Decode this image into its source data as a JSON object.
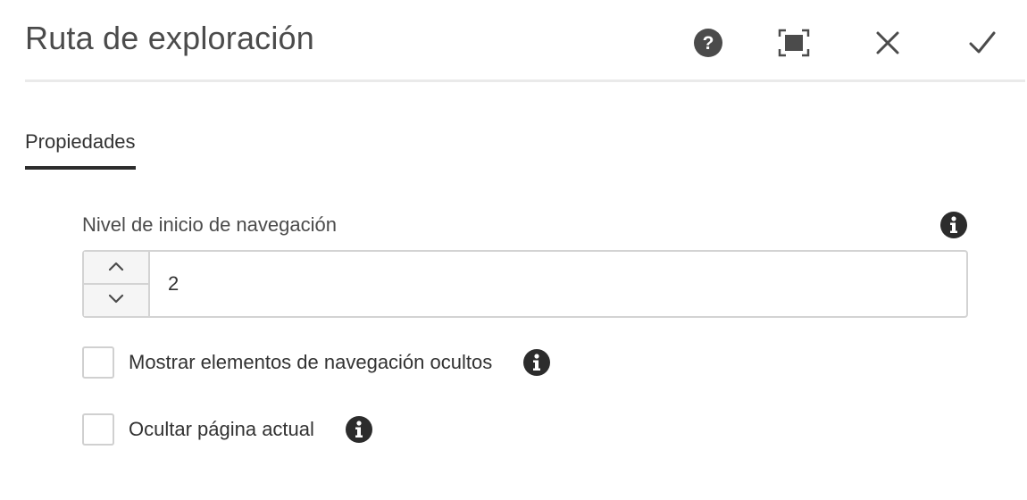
{
  "dialog": {
    "title": "Ruta de exploración",
    "actions": {
      "help_icon": "help-icon",
      "fullscreen_icon": "fullscreen-icon",
      "cancel_icon": "close-icon",
      "done_icon": "checkmark-icon"
    }
  },
  "tabs": [
    {
      "label": "Propiedades",
      "active": true
    }
  ],
  "fields": {
    "start_level": {
      "label": "Nivel de inicio de navegación",
      "value": "2",
      "info_icon": "info-icon",
      "increment_icon": "chevron-up-icon",
      "decrement_icon": "chevron-down-icon"
    },
    "show_hidden": {
      "label": "Mostrar elementos de navegación ocultos",
      "checked": false,
      "info_icon": "info-icon"
    },
    "hide_current": {
      "label": "Ocultar página actual",
      "checked": false,
      "info_icon": "info-icon"
    }
  },
  "colors": {
    "text": "#323232",
    "icon": "#2c2c2c",
    "border": "#d3d3d3",
    "divider": "#eaeaea"
  }
}
